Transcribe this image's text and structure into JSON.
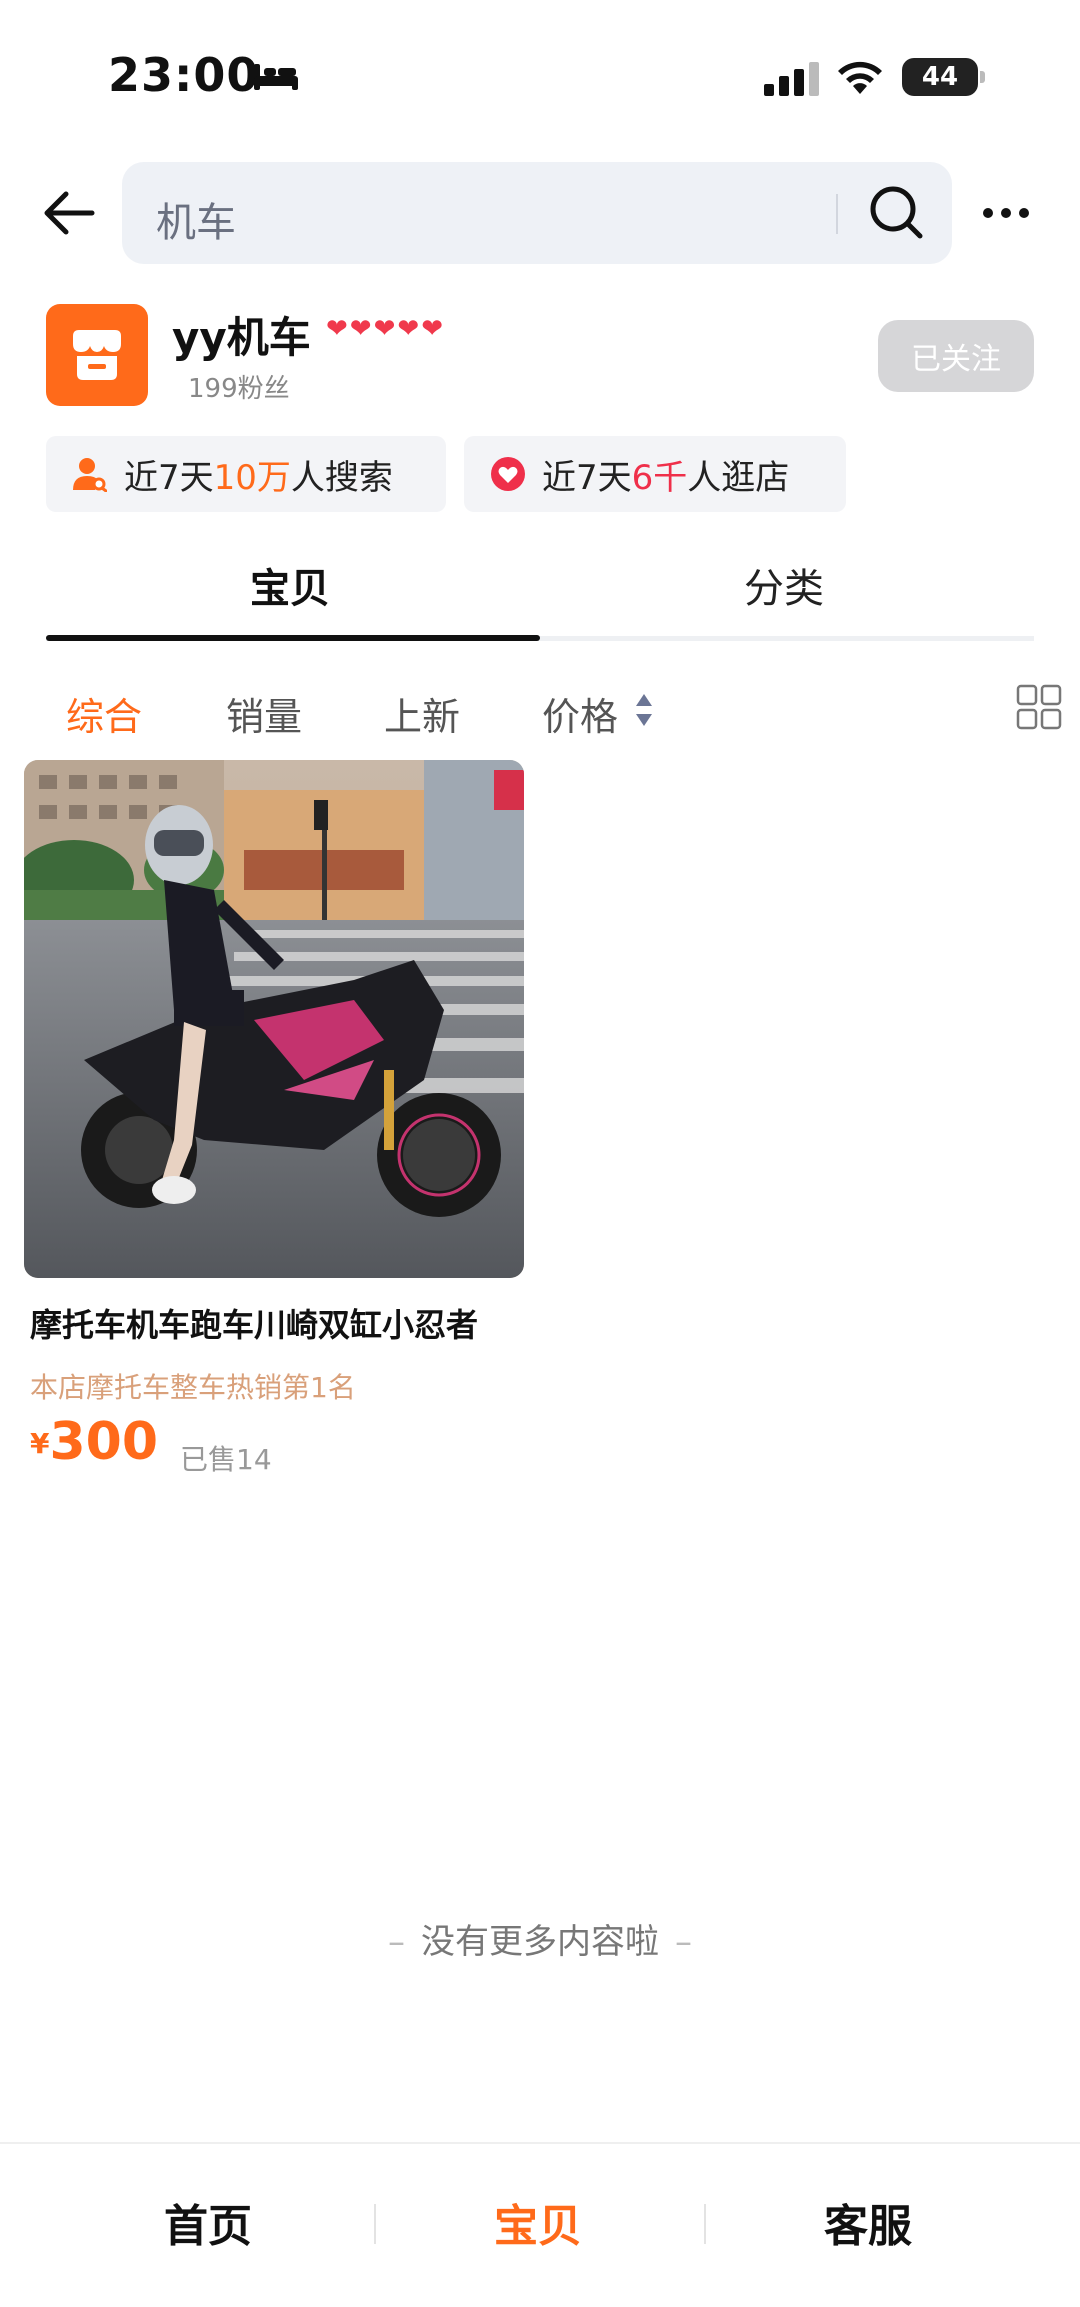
{
  "status_bar": {
    "time": "23:00",
    "battery": "44"
  },
  "search": {
    "query": "机车"
  },
  "shop": {
    "name": "yy机车",
    "fans": "199粉丝",
    "follow_label": "已关注",
    "hearts": [
      "❤",
      "❤",
      "❤",
      "❤",
      "❤"
    ]
  },
  "stats": {
    "search_prefix": "近7天",
    "search_number": "10万",
    "search_suffix": "人搜索",
    "visit_prefix": "近7天",
    "visit_number": "6千",
    "visit_suffix": "人逛店"
  },
  "tabs": {
    "products": "宝贝",
    "category": "分类"
  },
  "sort": {
    "comprehensive": "综合",
    "sales": "销量",
    "new": "上新",
    "price": "价格"
  },
  "product": {
    "title": "摩托车机车跑车川崎双缸小忍者",
    "rank": "本店摩托车整车热销第1名",
    "price_symbol": "¥",
    "price": "300",
    "sold": "已售14"
  },
  "footer": {
    "no_more": "没有更多内容啦"
  },
  "bottom_nav": {
    "home": "首页",
    "products": "宝贝",
    "service": "客服"
  },
  "colors": {
    "accent": "#ff6a1a",
    "red": "#ef2f4a",
    "search_bg": "#eef1f6"
  }
}
